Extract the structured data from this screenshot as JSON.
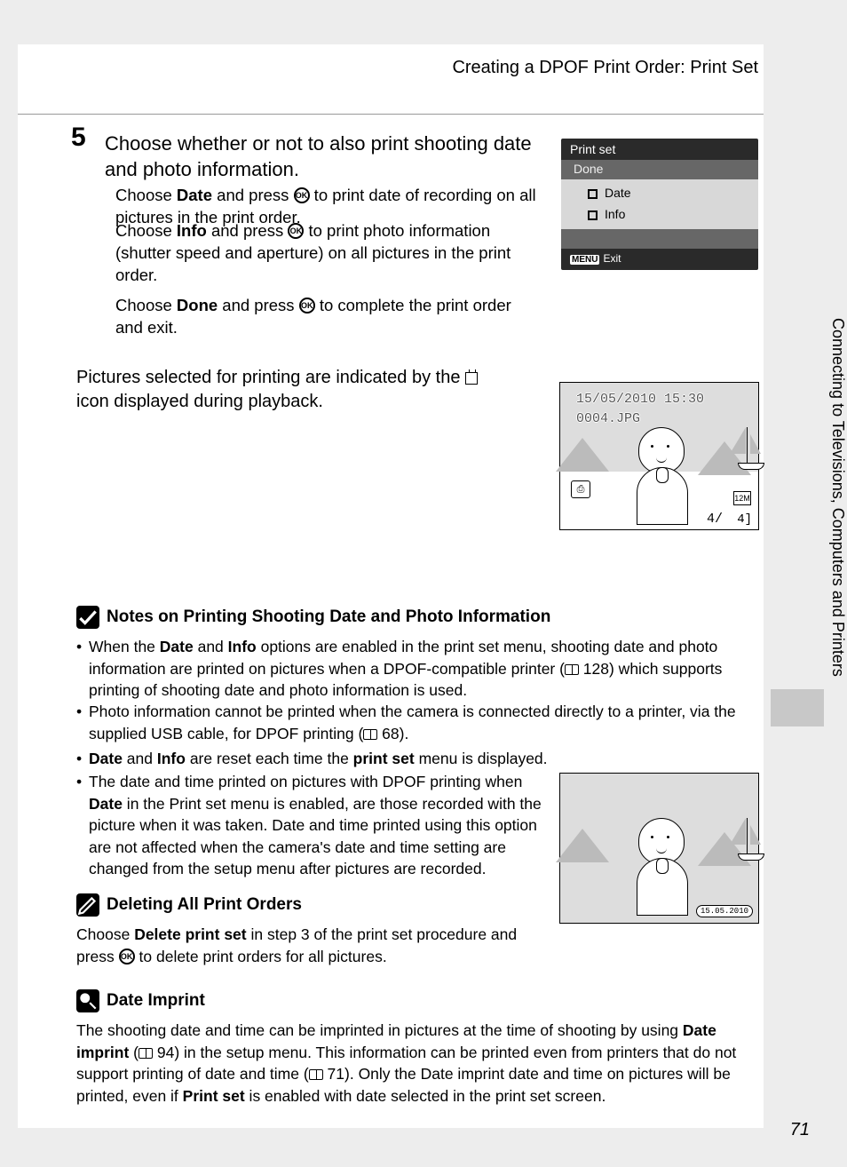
{
  "header": {
    "running": "Creating a DPOF Print Order: Print Set"
  },
  "step": {
    "num": "5",
    "title": "Choose whether or not to also print shooting date and photo information.",
    "p1a": "Choose ",
    "p1b": "Date",
    "p1c": " and press ",
    "p1d": " to print date of recording on all pictures in the print order.",
    "p2a": "Choose ",
    "p2b": "Info",
    "p2c": " and press ",
    "p2d": " to print photo information (shutter speed and aperture) on all pictures in the print order.",
    "p3a": "Choose ",
    "p3b": "Done",
    "p3c": " and press ",
    "p3d": " to complete the print order and exit.",
    "p4a": "Pictures selected for printing are indicated by the ",
    "p4b": " icon displayed during playback."
  },
  "lcd": {
    "title": "Print set",
    "done": "Done",
    "opt1": "Date",
    "opt2": "Info",
    "menu": "MENU",
    "exit": "Exit"
  },
  "lcd2": {
    "datetime": "15/05/2010 15:30",
    "file": "0004.JPG",
    "indicator": "⎙",
    "res": "12M",
    "count_cur": "4/",
    "count_tot": "4]"
  },
  "sidetab": "Connecting to Televisions, Computers and Printers",
  "notes1": {
    "title": "Notes on Printing Shooting Date and Photo Information",
    "b1a": "When the ",
    "b1b": "Date",
    "b1c": " and ",
    "b1d": "Info",
    "b1e": " options are enabled in the print set menu, shooting date and photo information are printed on pictures when a DPOF-compatible printer (",
    "b1f": " 128) which supports printing of shooting date and photo information is used.",
    "b2a": "Photo information cannot be printed when the camera is connected directly to a printer, via the supplied USB cable, for DPOF printing (",
    "b2b": " 68).",
    "b3a": "Date",
    "b3b": " and ",
    "b3c": "Info",
    "b3d": " are reset each time the ",
    "b3e": "print set",
    "b3f": " menu is displayed.",
    "b4a": "The date and time printed on pictures with DPOF printing when ",
    "b4b": "Date",
    "b4c": " in the Print set menu is enabled, are those recorded with the picture when it was taken. Date and time printed using this option are not affected when the camera's date and time setting are changed from the setup menu after pictures are recorded."
  },
  "notes2": {
    "title": "Deleting All Print Orders",
    "a": "Choose ",
    "b": "Delete print set",
    "c": " in step 3 of the print set procedure and press ",
    "d": " to delete print orders for all pictures."
  },
  "notes3": {
    "title": "Date Imprint",
    "a": "The shooting date and time can be imprinted in pictures at the time of shooting by using ",
    "b": "Date imprint",
    "c": " (",
    "d": " 94) in the setup menu. This information can be printed even from printers that do not support printing of date and time (",
    "e": " 71). Only the Date imprint date and time on pictures will be printed, even if ",
    "f": "Print set",
    "g": " is enabled with date selected in the print set screen."
  },
  "ill2": {
    "stamp": "15.05.2010"
  },
  "page_num": "71",
  "ok_label": "OK"
}
